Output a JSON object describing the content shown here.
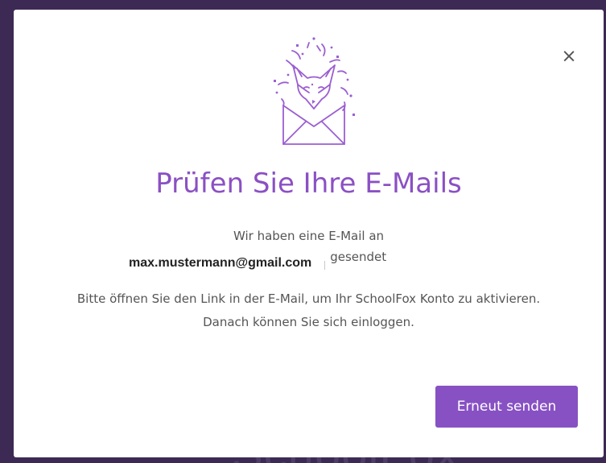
{
  "background": {
    "brand_text": "SchoolFox"
  },
  "dialog": {
    "close_label": "×",
    "title": "Prüfen Sie Ihre E-Mails",
    "line1": "Wir haben eine E-Mail an",
    "email": "max.mustermann@gmail.com",
    "sent": "gesendet",
    "body": "Bitte öffnen Sie den Link in der E-Mail, um Ihr SchoolFox Konto zu aktivieren. Danach können Sie sich einloggen.",
    "resend_label": "Erneut senden"
  },
  "colors": {
    "accent": "#8751c3",
    "title": "#8b50c4",
    "backdrop": "#3c2a55"
  },
  "icons": {
    "illustration": "fox-envelope-confetti-illustration",
    "close": "close-icon"
  }
}
